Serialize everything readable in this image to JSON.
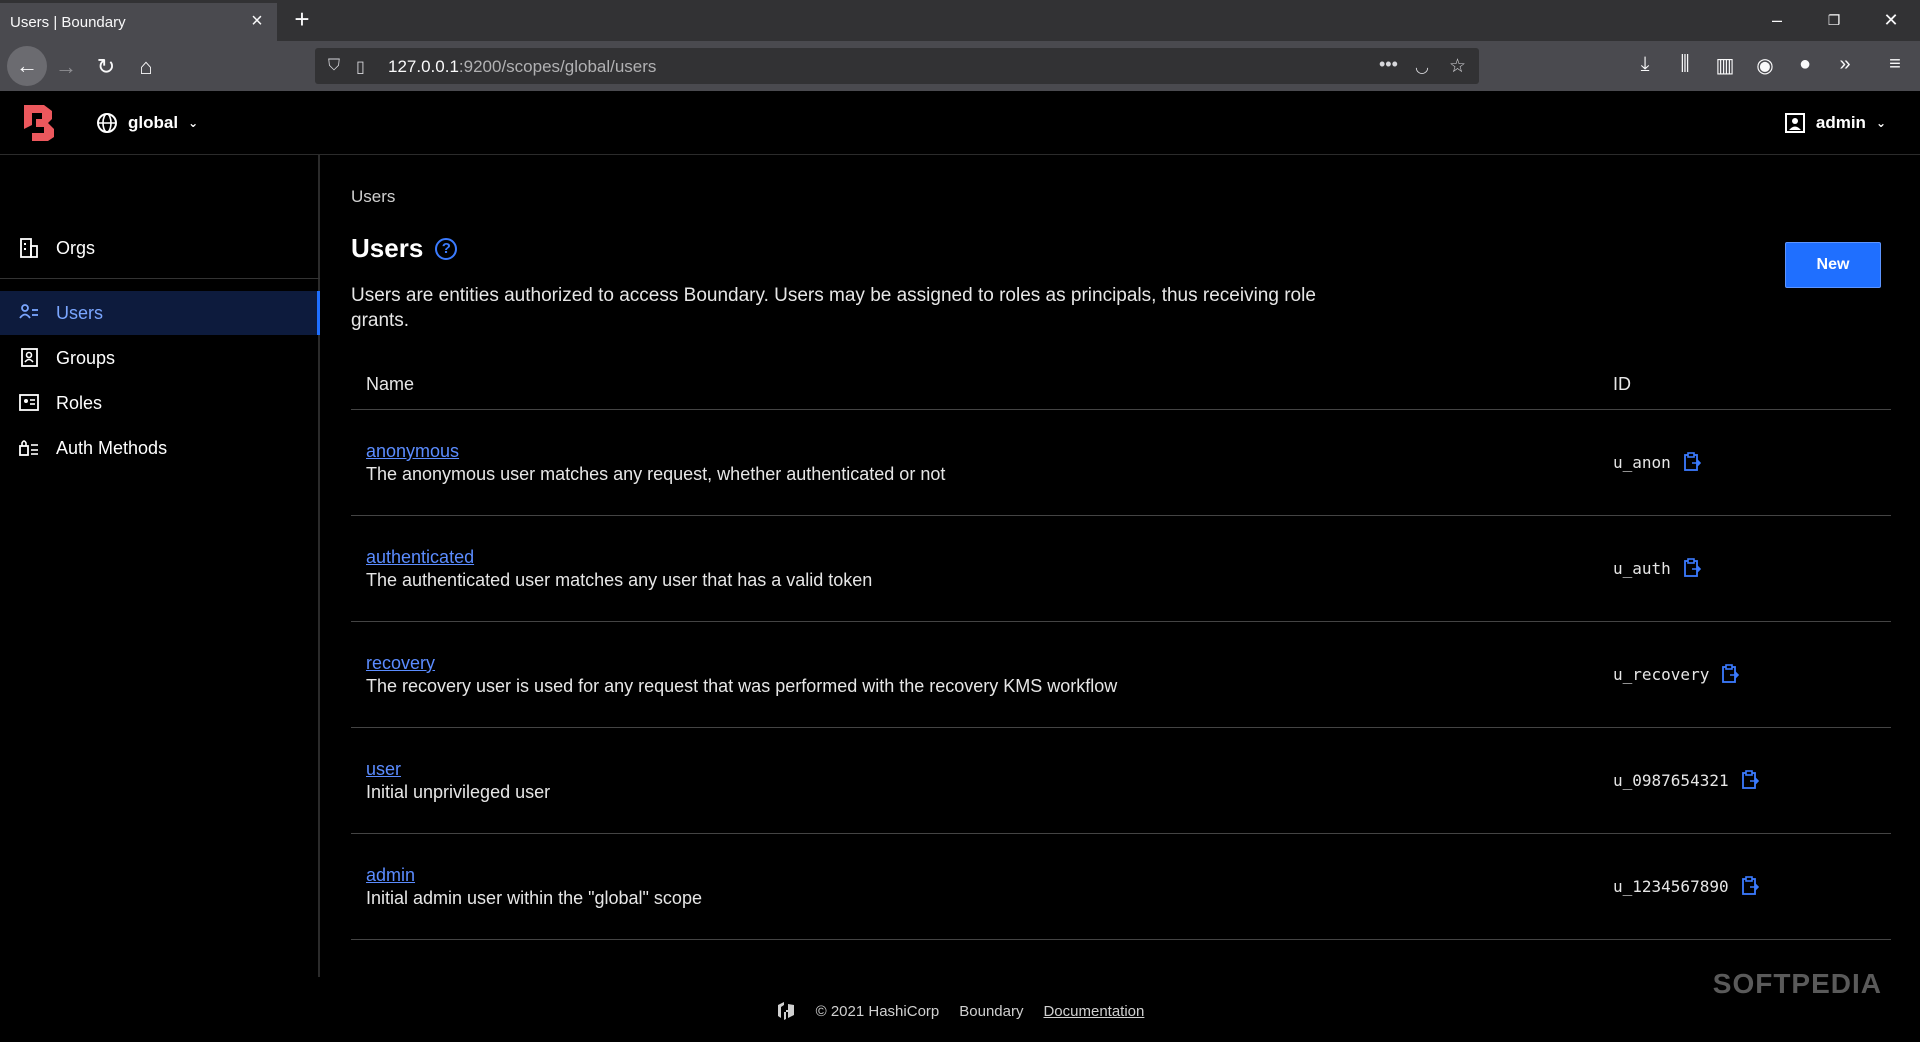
{
  "browser": {
    "tab_title": "Users | Boundary",
    "url_host": "127.0.0.1",
    "url_path": ":9200/scopes/global/users"
  },
  "header": {
    "scope_label": "global",
    "user_label": "admin"
  },
  "sidebar": {
    "items": [
      {
        "label": "Orgs"
      },
      {
        "label": "Users"
      },
      {
        "label": "Groups"
      },
      {
        "label": "Roles"
      },
      {
        "label": "Auth Methods"
      }
    ]
  },
  "main": {
    "breadcrumb": "Users",
    "title": "Users",
    "new_button": "New",
    "description": "Users are entities authorized to access Boundary. Users may be assigned to roles as principals, thus receiving role grants.",
    "columns": {
      "name": "Name",
      "id": "ID"
    },
    "rows": [
      {
        "name": "anonymous",
        "desc": "The anonymous user matches any request, whether authenticated or not",
        "id": "u_anon"
      },
      {
        "name": "authenticated",
        "desc": "The authenticated user matches any user that has a valid token",
        "id": "u_auth"
      },
      {
        "name": "recovery",
        "desc": "The recovery user is used for any request that was performed with the recovery KMS workflow",
        "id": "u_recovery"
      },
      {
        "name": "user",
        "desc": "Initial unprivileged user",
        "id": "u_0987654321"
      },
      {
        "name": "admin",
        "desc": "Initial admin user within the \"global\" scope",
        "id": "u_1234567890"
      }
    ]
  },
  "footer": {
    "copyright": "© 2021 HashiCorp",
    "product": "Boundary",
    "docs": "Documentation"
  },
  "watermark": "SOFTPEDIA",
  "colors": {
    "accent": "#1f6fff",
    "link": "#5b8cff",
    "brand": "#ec585d"
  }
}
